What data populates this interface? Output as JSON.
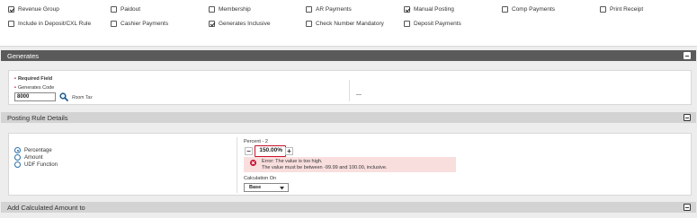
{
  "options": {
    "row1": [
      {
        "label": "Revenue Group",
        "checked": true
      },
      {
        "label": "Paidout",
        "checked": false
      },
      {
        "label": "Membership",
        "checked": false
      },
      {
        "label": "AR Payments",
        "checked": false
      },
      {
        "label": "Manual Posting",
        "checked": true
      },
      {
        "label": "Comp Payments",
        "checked": false
      },
      {
        "label": "Print Receipt",
        "checked": false
      }
    ],
    "row2": [
      {
        "label": "Include in Deposit/CXL Rule",
        "checked": false
      },
      {
        "label": "Cashier Payments",
        "checked": false
      },
      {
        "label": "Generates Inclusive",
        "checked": true
      },
      {
        "label": "Check Number Mandatory",
        "checked": false
      },
      {
        "label": "Deposit Payments",
        "checked": false
      }
    ]
  },
  "generates": {
    "section_title": "Generates",
    "required_note": "Required Field",
    "code_label": "Generates Code",
    "code_value": "8000",
    "code_description": "Room Tax",
    "right_value": "—"
  },
  "posting_rule": {
    "section_title": "Posting Rule Details",
    "radio_options": [
      {
        "label": "Percentage",
        "selected": true
      },
      {
        "label": "Amount",
        "selected": false
      },
      {
        "label": "UDF Function",
        "selected": false
      }
    ],
    "percent_label": "Percent - 2",
    "percent_value": "150.00%",
    "minus": "−",
    "plus": "+",
    "error_line1": "Error: The value is too high.",
    "error_line2": "The value must be between -99.99 and 100.00, inclusive.",
    "calc_label": "Calculation On",
    "calc_value": "Base"
  },
  "add_calculated": {
    "section_title": "Add Calculated Amount to"
  },
  "colors": {
    "error_bg": "#f9dede",
    "error_icon": "#c8102e",
    "dark_bar": "#5a5a5a",
    "light_bar": "#d3d3d3",
    "accent": "#2a6ea8"
  }
}
